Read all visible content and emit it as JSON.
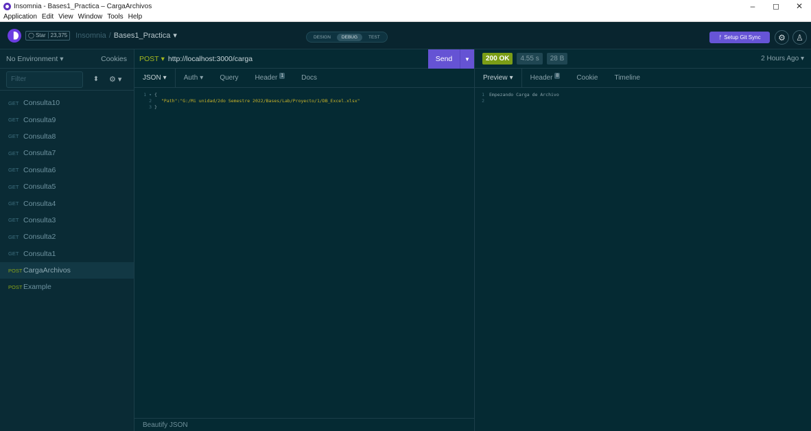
{
  "window": {
    "title": "Insomnia - Bases1_Practica – CargaArchivos",
    "controls": [
      "–",
      "◻",
      "✕"
    ]
  },
  "menu": [
    "Application",
    "Edit",
    "View",
    "Window",
    "Tools",
    "Help"
  ],
  "header": {
    "star_label": "Star",
    "star_count": "23,375",
    "breadcrumb_root": "Insomnia",
    "breadcrumb_sep": "/",
    "breadcrumb_current": "Bases1_Practica",
    "modes": [
      "DESIGN",
      "DEBUG",
      "TEST"
    ],
    "active_mode": "DEBUG",
    "git_sync_label": "Setup Git Sync"
  },
  "sidebar": {
    "environment": "No Environment",
    "cookies": "Cookies",
    "filter_placeholder": "Filter",
    "requests": [
      {
        "method": "GET",
        "name": "Consulta10"
      },
      {
        "method": "GET",
        "name": "Consulta9"
      },
      {
        "method": "GET",
        "name": "Consulta8"
      },
      {
        "method": "GET",
        "name": "Consulta7"
      },
      {
        "method": "GET",
        "name": "Consulta6"
      },
      {
        "method": "GET",
        "name": "Consulta5"
      },
      {
        "method": "GET",
        "name": "Consulta4"
      },
      {
        "method": "GET",
        "name": "Consulta3"
      },
      {
        "method": "GET",
        "name": "Consulta2"
      },
      {
        "method": "GET",
        "name": "Consulta1"
      },
      {
        "method": "POST",
        "name": "CargaArchivos"
      },
      {
        "method": "POST",
        "name": "Example"
      }
    ],
    "active_request": "CargaArchivos"
  },
  "request": {
    "method": "POST",
    "url": "http://localhost:3000/carga",
    "send_label": "Send",
    "tabs": {
      "body": "JSON",
      "auth": "Auth",
      "query": "Query",
      "header": "Header",
      "header_count": "1",
      "docs": "Docs"
    },
    "body_lines": [
      {
        "num": "1",
        "text": "{"
      },
      {
        "num": "2",
        "text": "\"Path\":\"G:/Mi unidad/2do Semestre 2022/Bases/Lab/Proyecto/1/DB_Excel.xlsx\""
      },
      {
        "num": "3",
        "text": "}"
      }
    ],
    "beautify_label": "Beautify JSON"
  },
  "response": {
    "status": "200 OK",
    "time": "4.55 s",
    "size": "28 B",
    "time_ago": "2 Hours Ago",
    "tabs": {
      "preview": "Preview",
      "header": "Header",
      "header_count": "8",
      "cookie": "Cookie",
      "timeline": "Timeline"
    },
    "body_lines": [
      {
        "num": "1",
        "text": "Empezando Carga de Archivo"
      },
      {
        "num": "2",
        "text": ""
      }
    ]
  }
}
